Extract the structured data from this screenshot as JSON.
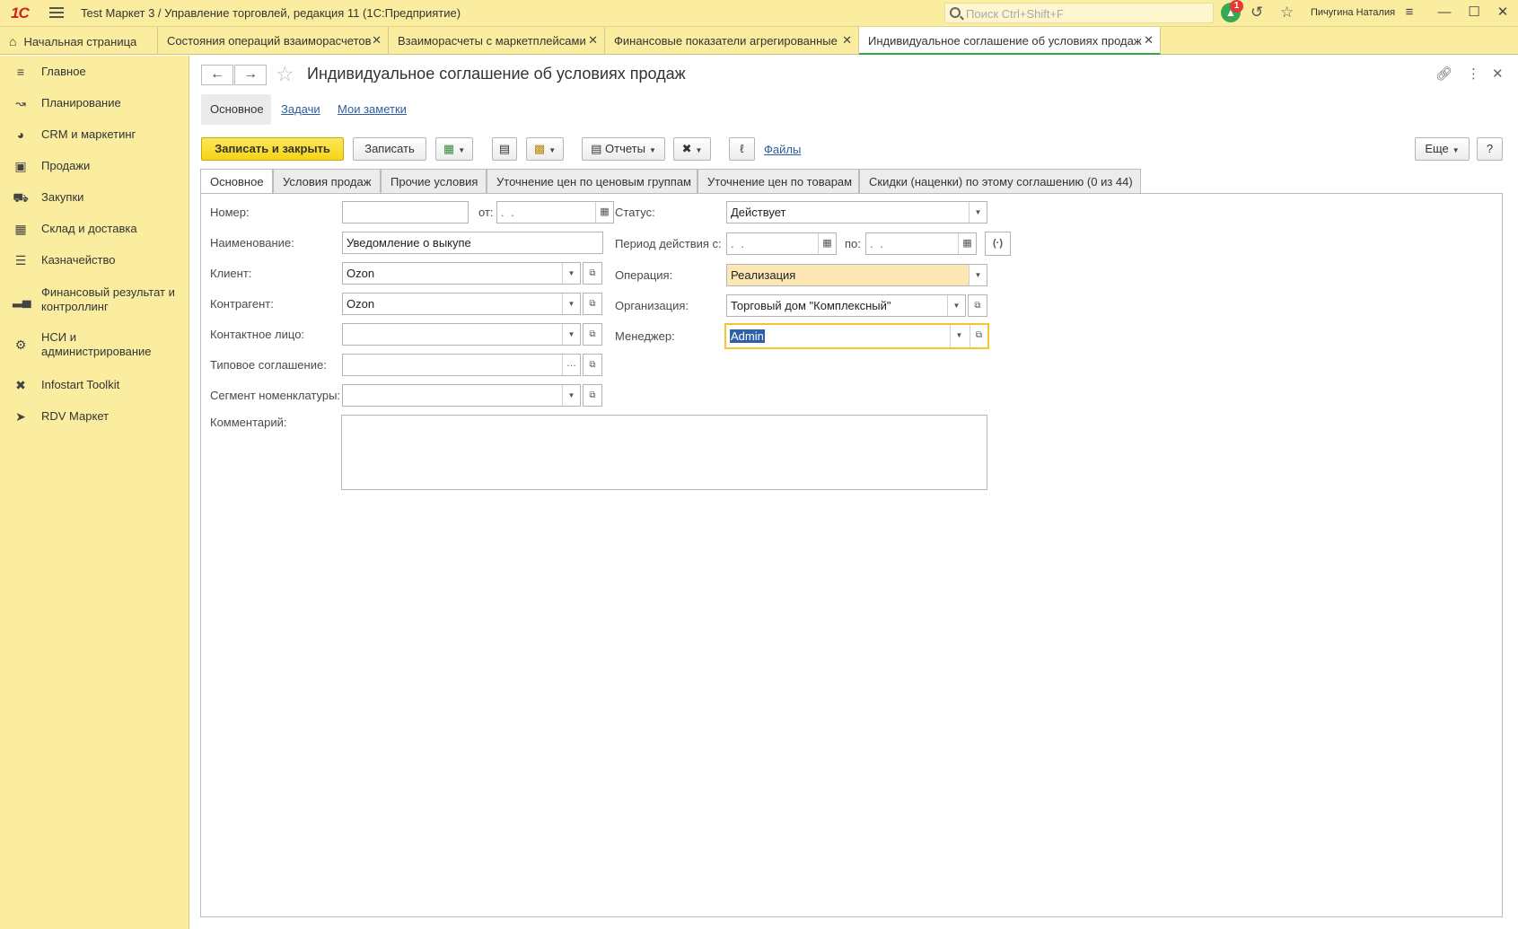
{
  "app": {
    "logo": "1С",
    "title": "Test Маркет 3 / Управление торговлей, редакция 11  (1С:Предприятие)",
    "search_placeholder": "Поиск Ctrl+Shift+F",
    "notification_count": "1",
    "user": "Пичугина Наталия"
  },
  "open_tabs": [
    {
      "label": "Начальная страница"
    },
    {
      "label": "Состояния операций взаиморасчетов"
    },
    {
      "label": "Взаиморасчеты с маркетплейсами"
    },
    {
      "label": "Финансовые показатели агрегированные"
    },
    {
      "label": "Индивидуальное соглашение об условиях продаж"
    }
  ],
  "sidebar": {
    "items": [
      {
        "label": "Главное",
        "icon": "menu-lines-icon"
      },
      {
        "label": "Планирование",
        "icon": "planning-icon"
      },
      {
        "label": "CRM и маркетинг",
        "icon": "pie-chart-icon"
      },
      {
        "label": "Продажи",
        "icon": "bag-icon"
      },
      {
        "label": "Закупки",
        "icon": "cart-icon"
      },
      {
        "label": "Склад и доставка",
        "icon": "warehouse-icon"
      },
      {
        "label": "Казначейство",
        "icon": "coins-icon"
      },
      {
        "label": "Финансовый результат и контроллинг",
        "icon": "bar-chart-icon"
      },
      {
        "label": "НСИ и администрирование",
        "icon": "gear-icon"
      },
      {
        "label": "Infostart Toolkit",
        "icon": "tools-icon"
      },
      {
        "label": "RDV Маркет",
        "icon": "rocket-icon"
      }
    ]
  },
  "form": {
    "title": "Индивидуальное соглашение об условиях продаж",
    "sections": [
      {
        "label": "Основное"
      },
      {
        "label": "Задачи"
      },
      {
        "label": "Мои заметки"
      }
    ]
  },
  "toolbar": {
    "save_close": "Записать и закрыть",
    "save": "Записать",
    "reports": "Отчеты",
    "files": "Файлы",
    "more": "Еще",
    "help": "?"
  },
  "page_tabs": [
    {
      "label": "Основное"
    },
    {
      "label": "Условия продаж"
    },
    {
      "label": "Прочие условия"
    },
    {
      "label": "Уточнение цен по ценовым группам"
    },
    {
      "label": "Уточнение цен по товарам"
    },
    {
      "label": "Скидки (наценки) по этому соглашению (0 из 44)"
    }
  ],
  "fields": {
    "number": {
      "label": "Номер:",
      "value": ""
    },
    "date": {
      "label": "от:",
      "value": " .  .  "
    },
    "name": {
      "label": "Наименование:",
      "value": "Уведомление о выкупе"
    },
    "client": {
      "label": "Клиент:",
      "value": "Ozon"
    },
    "counterparty": {
      "label": "Контрагент:",
      "value": "Ozon"
    },
    "contact": {
      "label": "Контактное лицо:",
      "value": ""
    },
    "standard_agreement": {
      "label": "Типовое соглашение:",
      "value": ""
    },
    "segment": {
      "label": "Сегмент номенклатуры:",
      "value": ""
    },
    "comment": {
      "label": "Комментарий:",
      "value": ""
    },
    "status": {
      "label": "Статус:",
      "value": "Действует"
    },
    "period_from": {
      "label": "Период действия с:",
      "value": " .  .  "
    },
    "period_to": {
      "label": "по:",
      "value": " .  .  "
    },
    "operation": {
      "label": "Операция:",
      "value": "Реализация"
    },
    "organization": {
      "label": "Организация:",
      "value": "Торговый дом \"Комплексный\""
    },
    "manager": {
      "label": "Менеджер:",
      "value": "Admin"
    }
  },
  "colors": {
    "sidebar_bg": "#fbeda0",
    "primary_button": "#f7d414",
    "active_tab_underline": "#37a34a",
    "link": "#2d5d9c",
    "highlight_field": "#fde8b5",
    "selection": "#2f5fa8"
  }
}
